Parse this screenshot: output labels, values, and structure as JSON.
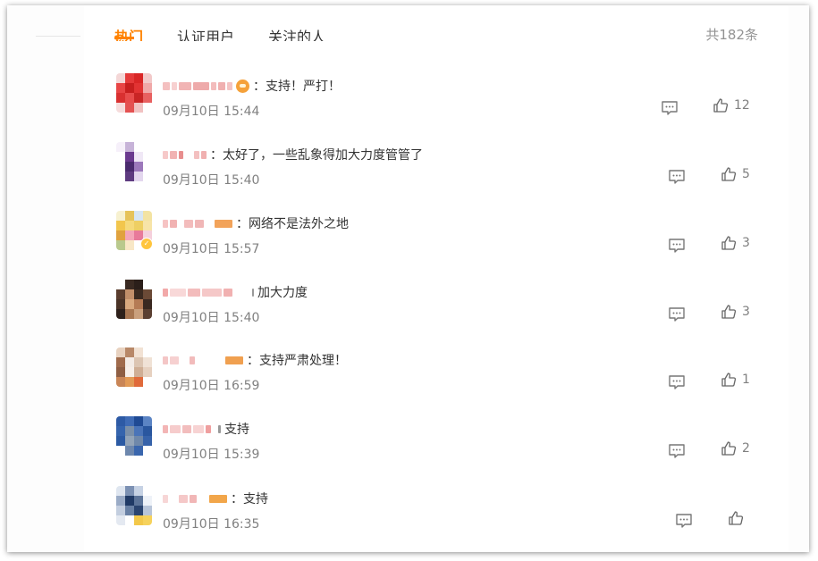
{
  "tabs": [
    {
      "label": "热门",
      "active": true
    },
    {
      "label": "认证用户",
      "active": false
    },
    {
      "label": "关注的人",
      "active": false
    }
  ],
  "total_label": "共182条",
  "icons": {
    "reply": "comment-icon",
    "like": "thumbs-up-icon",
    "emoji": "emoji-icon",
    "verified": "verified-badge-icon"
  },
  "colors": {
    "accent": "#ff8200",
    "text": "#333333",
    "muted": "#808080"
  },
  "comments": [
    {
      "sep": "：",
      "text": "支持！严打！",
      "time": "09月10日 15:44",
      "likes": "12"
    },
    {
      "sep": "：",
      "text": "太好了，一些乱象得加大力度管管了",
      "time": "09月10日 15:40",
      "likes": "5"
    },
    {
      "sep": "：",
      "text": "网络不是法外之地",
      "time": "09月10日 15:57",
      "likes": "3"
    },
    {
      "sep": "",
      "text": "加大力度",
      "time": "09月10日 15:40",
      "likes": "3"
    },
    {
      "sep": "：",
      "text": "支持严肃处理！",
      "time": "09月10日 16:59",
      "likes": "1"
    },
    {
      "sep": "",
      "text": "支持",
      "time": "09月10日 15:39",
      "likes": "2"
    },
    {
      "sep": "：",
      "text": "支持",
      "time": "09月10日 16:35",
      "likes": ""
    }
  ]
}
